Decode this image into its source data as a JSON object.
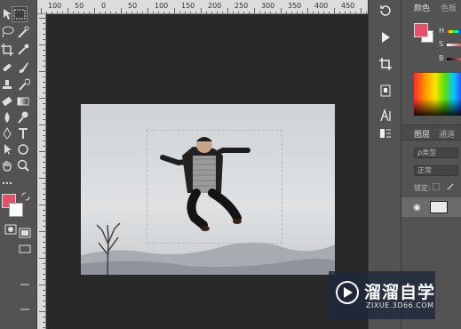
{
  "ruler": {
    "labels": [
      "100",
      "50",
      "0",
      "50",
      "100",
      "150",
      "200",
      "250",
      "300",
      "350",
      "400",
      "450"
    ]
  },
  "panels": {
    "color_tab": "颜色",
    "swatches_tab": "色板",
    "slider_h": "H",
    "slider_s": "S",
    "slider_b": "B",
    "layers_tab": "图层",
    "channels_tab": "通道",
    "filter_kind": "ρ类型",
    "blend_mode": "正常",
    "lock_label": "锁定:"
  },
  "colors": {
    "foreground": "#e8506a",
    "background": "#ffffff",
    "watermark_bg": "#1e283c"
  },
  "watermark": {
    "title": "溜溜自学",
    "url": "ZIXUE.3D66.COM"
  },
  "icons": [
    "marquee-tool-icon",
    "lasso-tool-icon",
    "quick-select-icon",
    "crop-icon",
    "eyedropper-icon",
    "brush-icon",
    "stamp-icon",
    "history-brush-icon",
    "eraser-icon",
    "gradient-icon",
    "blur-icon",
    "dodge-icon",
    "pen-icon",
    "type-icon",
    "path-select-icon",
    "shape-icon",
    "zoom-icon",
    "hand-icon",
    "play-icon",
    "paragraph-icon",
    "character-icon"
  ]
}
